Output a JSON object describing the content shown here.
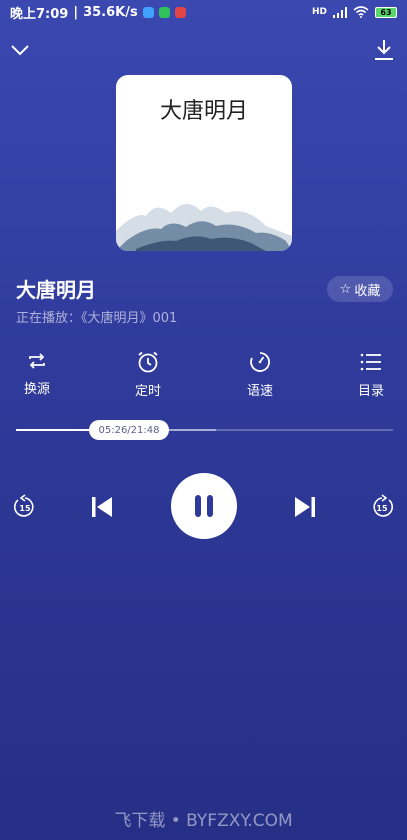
{
  "status": {
    "time_text": "晚上7:09",
    "speed_text": "35.6K/s",
    "battery": "63",
    "network_label": "HD"
  },
  "album": {
    "cover_title": "大唐明月"
  },
  "track": {
    "title": "大唐明月",
    "favorite_label": "收藏",
    "now_playing_label": "正在播放：",
    "now_playing_value": "《大唐明月》001"
  },
  "functions": [
    {
      "label": "换源",
      "icon": "switch-source-icon"
    },
    {
      "label": "定时",
      "icon": "alarm-clock-icon"
    },
    {
      "label": "语速",
      "icon": "speed-icon"
    },
    {
      "label": "目录",
      "icon": "list-icon"
    }
  ],
  "progress": {
    "time_text": "05:26/21:48",
    "fraction": 0.25,
    "buffer_fraction": 0.53
  },
  "controls": {
    "rewind_seconds": "15",
    "forward_seconds": "15"
  },
  "watermark": "飞下载 • BYFZXY.COM",
  "colors": {
    "accent": "#2f3a9a",
    "play_button": "#ffffff"
  }
}
